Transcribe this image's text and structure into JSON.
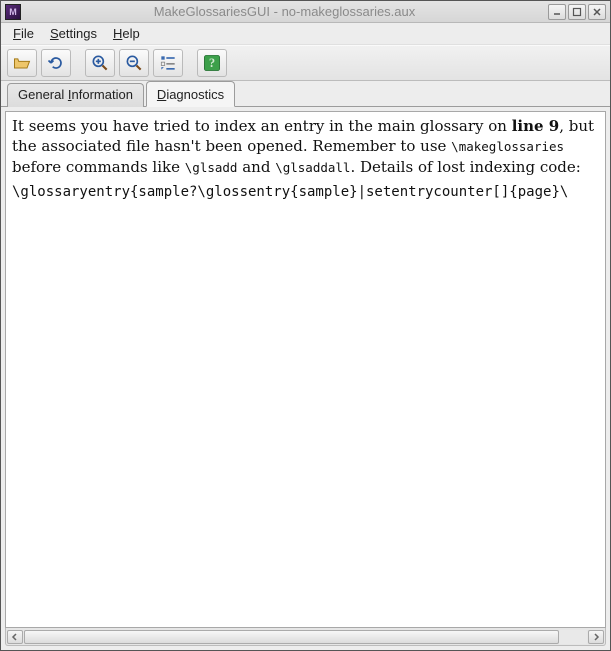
{
  "window": {
    "title": "MakeGlossariesGUI - no-makeglossaries.aux"
  },
  "menubar": {
    "file": "File",
    "settings": "Settings",
    "help": "Help",
    "file_mn": "F",
    "settings_mn": "S",
    "help_mn": "H"
  },
  "tabs": {
    "general": "General Information",
    "general_mn": "I",
    "diagnostics": "Diagnostics",
    "diagnostics_mn": "D",
    "active": "diagnostics"
  },
  "diagnostics": {
    "p1_a": "It seems you have tried to index an entry in the main glossary on ",
    "p1_bold": "line 9",
    "p1_b": ", but the associated file hasn't been opened. Remember to use ",
    "p1_tt1": "\\makeglossaries",
    "p1_c": " before commands like ",
    "p1_tt2": "\\glsadd",
    "p1_d": " and ",
    "p1_tt3": "\\glsaddall",
    "p1_e": ". Details of lost indexing code:",
    "code": "\\glossaryentry{sample?\\glossentry{sample}|setentrycounter[]{page}\\"
  }
}
